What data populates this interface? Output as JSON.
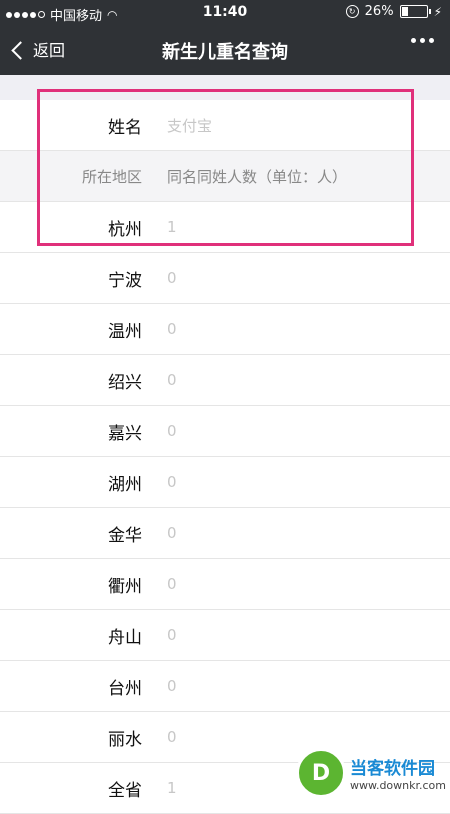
{
  "status_bar": {
    "carrier": "中国移动",
    "time": "11:40",
    "battery": "26%",
    "battery_level": 0.26
  },
  "nav": {
    "back_label": "返回",
    "title": "新生儿重名查询"
  },
  "table": {
    "name_label": "姓名",
    "name_value": "支付宝",
    "region_header": "所在地区",
    "count_header": "同名同姓人数（单位：人）",
    "rows": [
      {
        "region": "杭州",
        "count": "1"
      },
      {
        "region": "宁波",
        "count": "0"
      },
      {
        "region": "温州",
        "count": "0"
      },
      {
        "region": "绍兴",
        "count": "0"
      },
      {
        "region": "嘉兴",
        "count": "0"
      },
      {
        "region": "湖州",
        "count": "0"
      },
      {
        "region": "金华",
        "count": "0"
      },
      {
        "region": "衢州",
        "count": "0"
      },
      {
        "region": "舟山",
        "count": "0"
      },
      {
        "region": "台州",
        "count": "0"
      },
      {
        "region": "丽水",
        "count": "0"
      },
      {
        "region": "全省",
        "count": "1"
      }
    ]
  },
  "watermark": {
    "logo_letter": "D",
    "name": "当客软件园",
    "url": "www.downkr.com"
  },
  "colors": {
    "nav_bg": "#2f3236",
    "highlight": "#e0307a",
    "placeholder_text": "#c7c7c7"
  }
}
